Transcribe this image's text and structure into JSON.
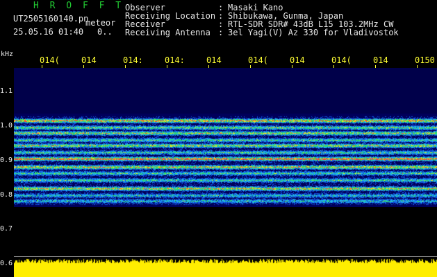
{
  "header": {
    "app_title": "H R O F F T",
    "filename": "UT2505160140.pn",
    "meteor_tag": "meteor",
    "date_time": "25.05.16 01:40",
    "count": "0..",
    "info": [
      {
        "label": "Observer",
        "value": "Masaki Kano"
      },
      {
        "label": "Receiving Location",
        "value": "Shibukawa, Gunma, Japan"
      },
      {
        "label": "Receiver",
        "value": "RTL-SDR SDR# 43dB L15 103.2MHz CW"
      },
      {
        "label": "Receiving Antenna",
        "value": "3el Yagi(V) Az 330 for Vladivostok"
      }
    ]
  },
  "axis": {
    "unit": "kHz",
    "time_ticks": [
      "014(",
      "014",
      "014:",
      "014:",
      "014",
      "014(",
      "014",
      "014(",
      "014",
      "0150"
    ],
    "freq_ticks": [
      "1.1",
      "1.0",
      "0.9",
      "0.8",
      "0.7",
      "0.6"
    ]
  },
  "colors": {
    "background": "#000000",
    "title_green": "#22cc33",
    "tick_yellow": "#ffff33",
    "power_yellow": "#ffee00",
    "spectrum_base": "#00005a",
    "hot_line": "#ff3333"
  }
}
